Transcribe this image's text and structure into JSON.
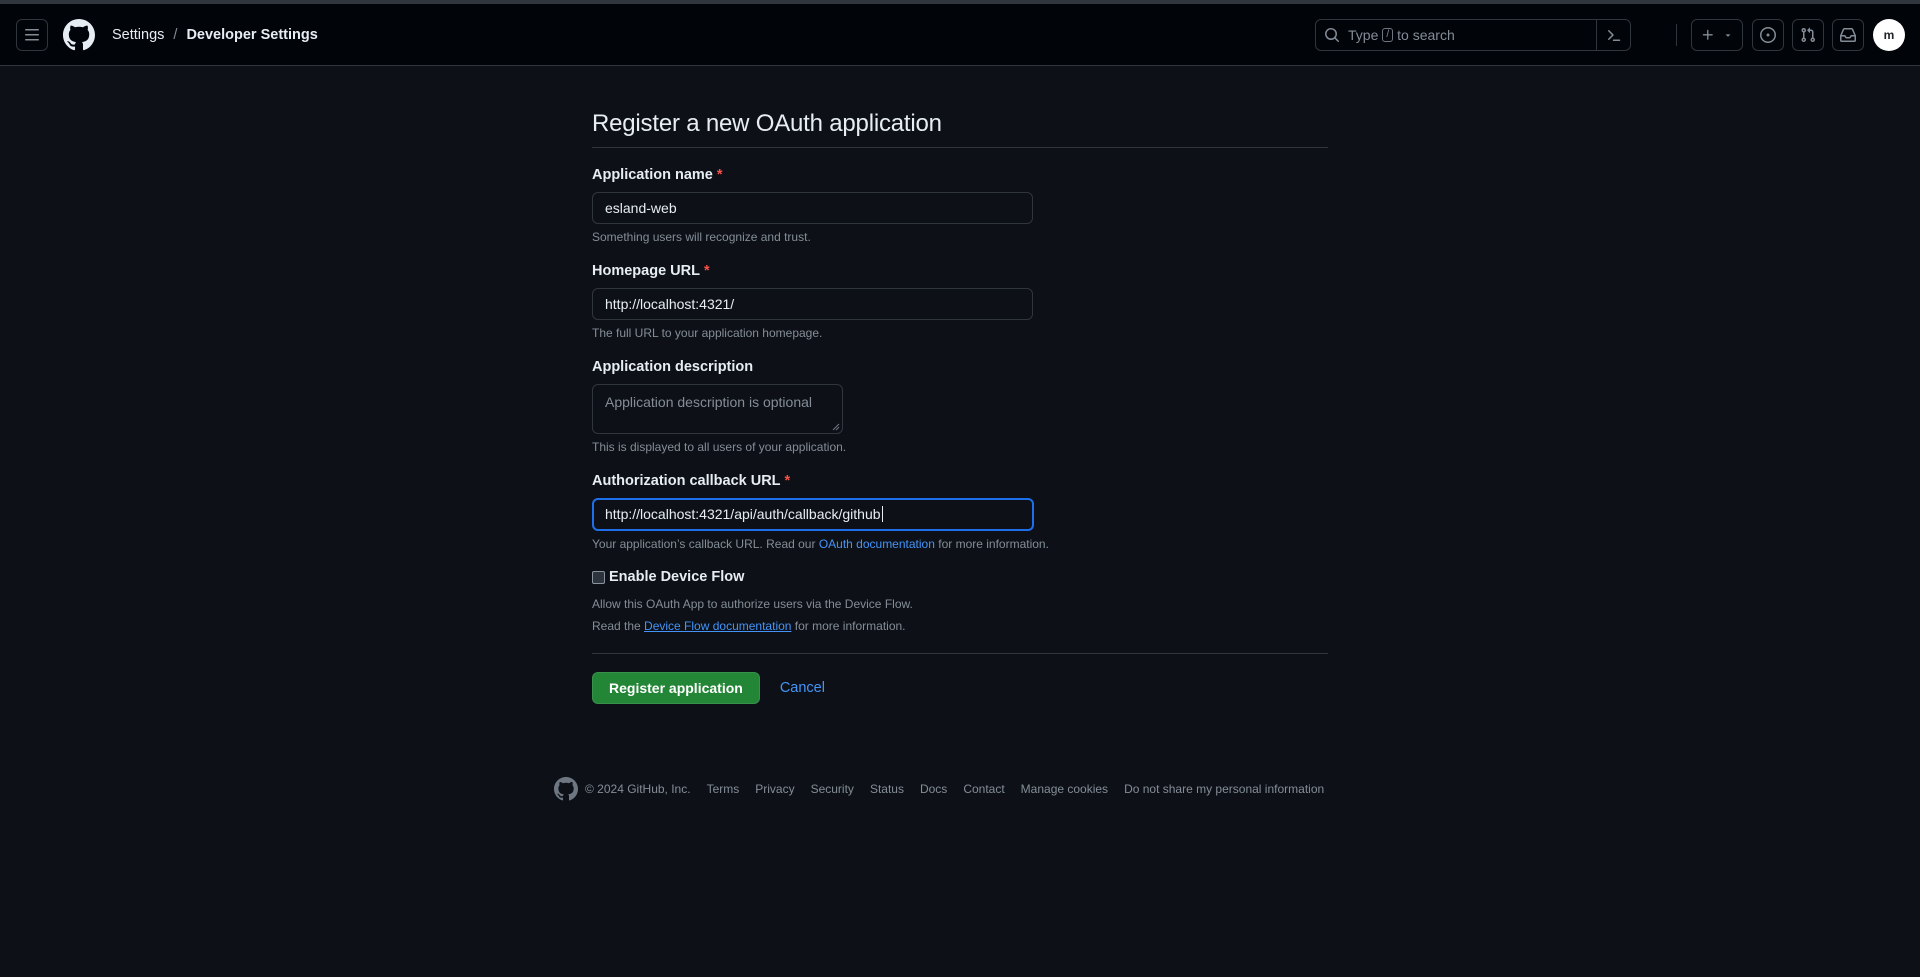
{
  "header": {
    "breadcrumb": {
      "settings": "Settings",
      "separator": "/",
      "current": "Developer Settings"
    },
    "search": {
      "prefix": "Type",
      "key": "/",
      "suffix": "to search"
    },
    "avatar_initial": "m"
  },
  "main": {
    "title": "Register a new OAuth application",
    "fields": {
      "app_name": {
        "label": "Application name",
        "required": "*",
        "value": "esland-web",
        "note": "Something users will recognize and trust."
      },
      "homepage": {
        "label": "Homepage URL",
        "required": "*",
        "value": "http://localhost:4321/",
        "note": "The full URL to your application homepage."
      },
      "description": {
        "label": "Application description",
        "placeholder": "Application description is optional",
        "note": "This is displayed to all users of your application."
      },
      "callback": {
        "label": "Authorization callback URL",
        "required": "*",
        "value": "http://localhost:4321/api/auth/callback/github",
        "note_prefix": "Your application’s callback URL. Read our",
        "note_link": "OAuth documentation",
        "note_suffix": "for more information."
      }
    },
    "device_flow": {
      "label": "Enable Device Flow",
      "checked": false,
      "line1": "Allow this OAuth App to authorize users via the Device Flow.",
      "line2_prefix": "Read the",
      "line2_link": "Device Flow documentation",
      "line2_suffix": "for more information."
    },
    "actions": {
      "register": "Register application",
      "cancel": "Cancel"
    }
  },
  "footer": {
    "copyright": "© 2024 GitHub, Inc.",
    "links": [
      "Terms",
      "Privacy",
      "Security",
      "Status",
      "Docs",
      "Contact",
      "Manage cookies",
      "Do not share my personal information"
    ]
  },
  "colors": {
    "background": "#0d1117",
    "header": "#010409",
    "accent": "#4493f8",
    "primary": "#238636",
    "focus": "#1f6feb",
    "required": "#f85149"
  }
}
